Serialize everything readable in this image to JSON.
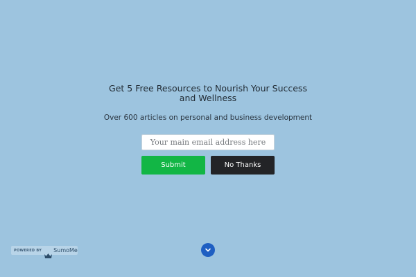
{
  "modal": {
    "headline": "Get 5 Free Resources to Nourish Your Success and Wellness",
    "subheadline": "Over 600 articles on personal and business development",
    "email_placeholder": "Your main email address here",
    "email_value": "",
    "submit_label": "Submit",
    "no_thanks_label": "No Thanks"
  },
  "branding": {
    "powered_by": "POWERED BY",
    "brand_name": "SumoMe",
    "icon": "crown-icon"
  },
  "scroll_button": {
    "icon": "chevron-down-icon"
  },
  "colors": {
    "background": "#9dc4df",
    "submit": "#12b645",
    "no_thanks": "#232427",
    "scroll_button": "#1f5fc2"
  }
}
